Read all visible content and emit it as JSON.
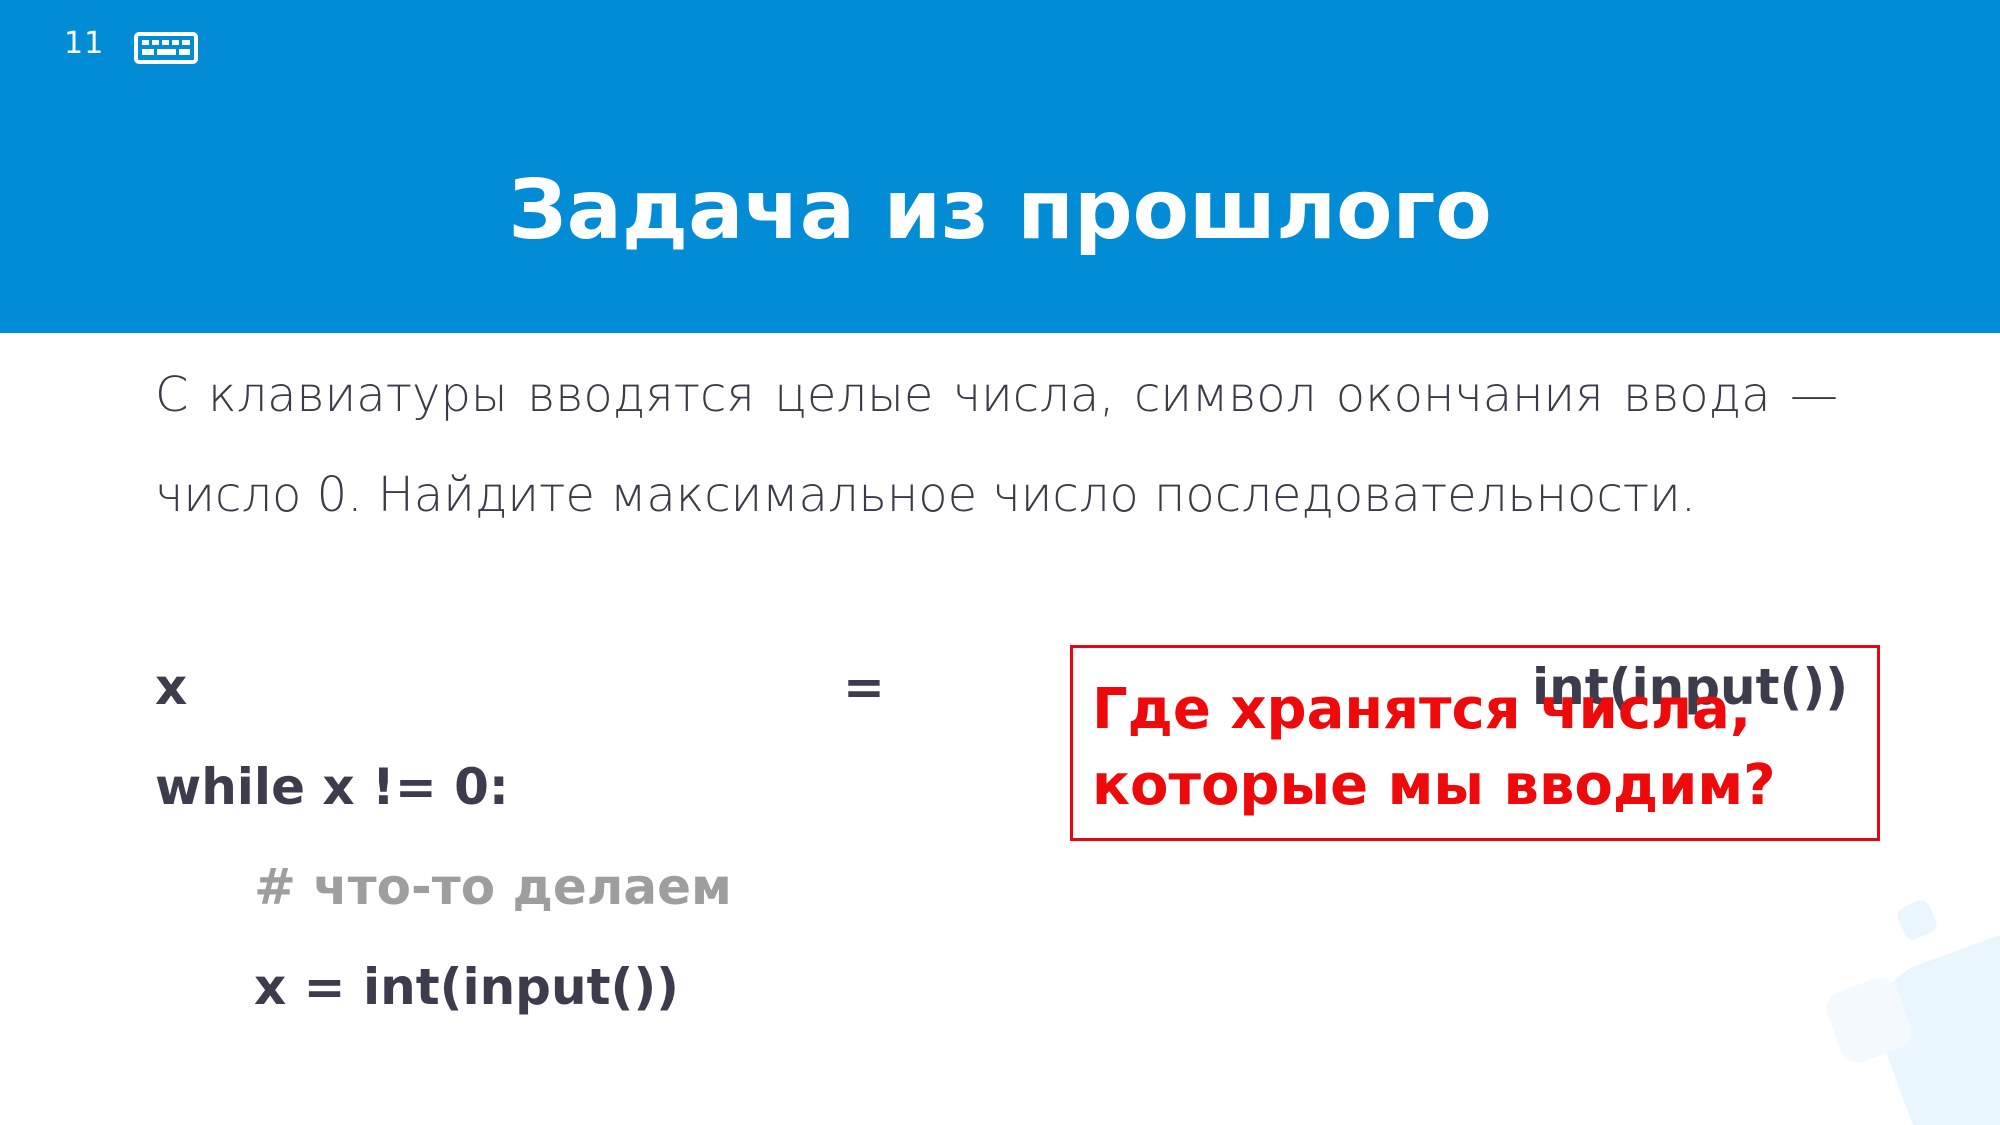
{
  "slide": {
    "number": "11",
    "title": "Задача из прошлого"
  },
  "task": {
    "text": "С клавиатуры вводятся целые числа, символ окончания ввода — число 0. Найдите максимальное число последовательности."
  },
  "code": {
    "line1_var": "x",
    "line1_eq": "=",
    "line1_call": "int(input())",
    "line2": "while x != 0:",
    "line3_comment": "# что-то делаем",
    "line4": "x = int(input())"
  },
  "callout": {
    "line1": "Где хранятся числа,",
    "line2": "которые мы вводим?"
  },
  "colors": {
    "header": "#028CD6",
    "callout_border": "#E30613",
    "callout_text": "#EE0A0A",
    "code": "#3C3C4C",
    "comment": "#9E9E9E"
  },
  "icons": [
    "keyboard-icon",
    "decorative-shapes"
  ]
}
